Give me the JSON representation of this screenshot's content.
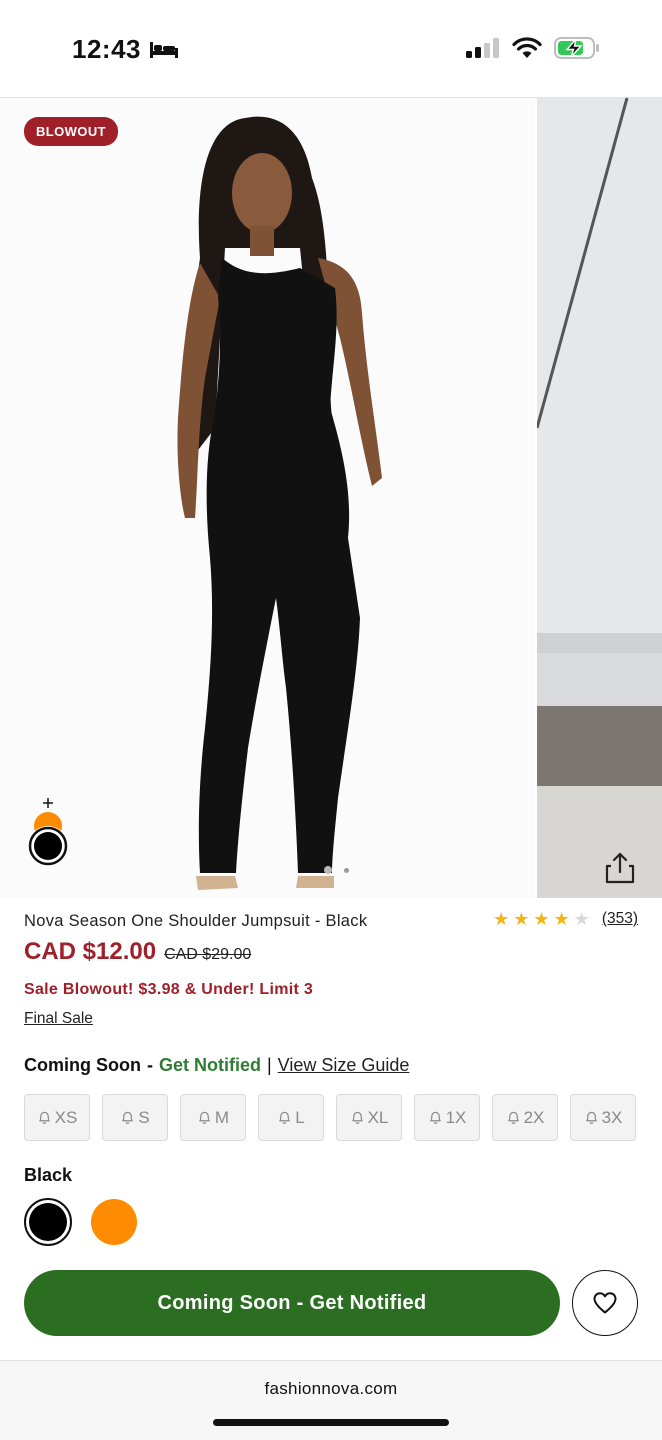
{
  "status_bar": {
    "time": "12:43"
  },
  "gallery": {
    "badge": "BLOWOUT",
    "dots_count": 2,
    "active_dot": 0
  },
  "product": {
    "title": "Nova Season One Shoulder Jumpsuit - Black",
    "rating": 4,
    "rating_max": 5,
    "review_count": "(353)",
    "price": "CAD $12.00",
    "original_price": "CAD $29.00",
    "promo": "Sale Blowout! $3.98 & Under! Limit 3",
    "final_sale": "Final Sale"
  },
  "availability": {
    "status": "Coming Soon",
    "separator": "-",
    "notify": "Get Notified",
    "divider": "|",
    "size_guide": "View Size Guide"
  },
  "sizes": [
    "XS",
    "S",
    "M",
    "L",
    "XL",
    "1X",
    "2X",
    "3X"
  ],
  "colors": {
    "selected_label": "Black",
    "options": [
      {
        "name": "Black",
        "hex": "#000000"
      },
      {
        "name": "Orange",
        "hex": "#ff8c00"
      }
    ]
  },
  "cta": {
    "label": "Coming Soon - Get Notified"
  },
  "browser": {
    "url": "fashionnova.com"
  },
  "theme": {
    "sale_red": "#a0202a",
    "notify_green": "#2e7d32",
    "button_green": "#2b6e22"
  }
}
